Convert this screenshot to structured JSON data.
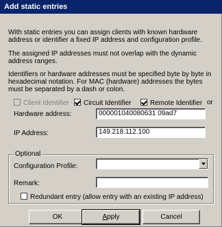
{
  "title": "Add static entries",
  "paragraphs": [
    "With static entries you can assign clients with known hardware address or identifier a fixed IP address and configuration profile.",
    "The assigned IP addresses must not overlap with the dynamic address ranges.",
    "Identifiers or hardware addresses must be specified byte by byte in hexadecimal notation. For MAC (hardware) addresses the bytes must be separated by a dash or colon."
  ],
  "options": {
    "client_identifier": {
      "label": "Client Identifier",
      "checked": false,
      "enabled": false
    },
    "circuit_identifier": {
      "label": "Circuit Identifier",
      "checked": true
    },
    "remote_identifier": {
      "label": "Remote Identifier",
      "checked": true
    },
    "or_text": "or"
  },
  "hardware_address": {
    "label": "Hardware address:",
    "value": "000001040080631 09ad7"
  },
  "ip_address": {
    "label": "IP Address:",
    "value": "149.218.112.100"
  },
  "optional": {
    "group_label": "Optional",
    "configuration_profile": {
      "label": "Configuration Profile:",
      "value": ""
    },
    "remark": {
      "label": "Remark:",
      "value": ""
    },
    "redundant": {
      "label": "Redundant entry (allow entry with an existing IP address)",
      "checked": false
    }
  },
  "buttons": {
    "ok": "OK",
    "apply": "Apply",
    "cancel": "Cancel"
  }
}
